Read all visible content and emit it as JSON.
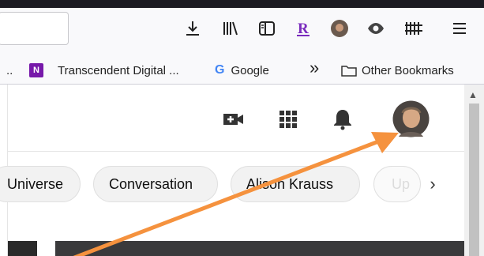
{
  "browser": {
    "toolbar_icons": [
      "download-icon",
      "library-icon",
      "sidebar-icon",
      "r-extension-icon",
      "profile-avatar-icon",
      "eye-icon",
      "extension-grid-icon",
      "menu-icon"
    ],
    "bookmarks": {
      "overflow_dot": "..",
      "item1": "Transcendent Digital ...",
      "item2_letter": "G",
      "item2": "Google",
      "more": "»",
      "other": "Other Bookmarks"
    }
  },
  "page": {
    "chips": [
      "Universe",
      "Conversation",
      "Alison Krauss",
      "Up"
    ],
    "chips_next": "›",
    "icons": [
      "create-video-icon",
      "apps-grid-icon",
      "notifications-bell-icon",
      "account-avatar"
    ]
  },
  "annotation": {
    "color": "#f5923e"
  }
}
